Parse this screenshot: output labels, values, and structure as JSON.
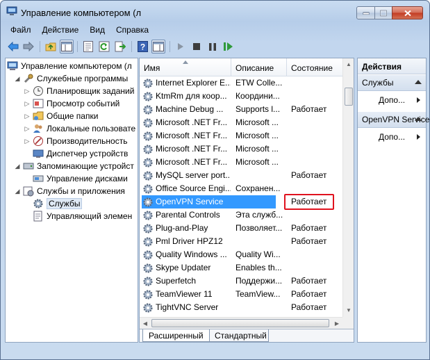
{
  "window": {
    "title": "Управление компьютером (л",
    "buttons": {
      "minimize": "minimize",
      "maximize": "maximize",
      "close": "close"
    }
  },
  "menu": [
    "Файл",
    "Действие",
    "Вид",
    "Справка"
  ],
  "toolbar": {
    "icons": [
      "back-arrow-icon",
      "forward-arrow-icon",
      "up-folder-icon",
      "show-tree-icon",
      "properties-icon",
      "refresh-icon",
      "export-icon",
      "help-icon",
      "show-action-pane-icon",
      "start-icon",
      "stop-icon",
      "pause-icon",
      "resume-icon"
    ]
  },
  "tree": [
    {
      "label": "Управление компьютером (л",
      "level": 0,
      "toggle": "",
      "icon": "computer-management-icon"
    },
    {
      "label": "Служебные программы",
      "level": 1,
      "toggle": "expanded",
      "icon": "tools-icon"
    },
    {
      "label": "Планировщик заданий",
      "level": 2,
      "toggle": "collapsed",
      "icon": "clock-icon"
    },
    {
      "label": "Просмотр событий",
      "level": 2,
      "toggle": "collapsed",
      "icon": "event-viewer-icon"
    },
    {
      "label": "Общие папки",
      "level": 2,
      "toggle": "collapsed",
      "icon": "shared-folder-icon"
    },
    {
      "label": "Локальные пользовате",
      "level": 2,
      "toggle": "collapsed",
      "icon": "users-icon"
    },
    {
      "label": "Производительность",
      "level": 2,
      "toggle": "collapsed",
      "icon": "performance-icon"
    },
    {
      "label": "Диспетчер устройств",
      "level": 2,
      "toggle": "",
      "icon": "device-manager-icon"
    },
    {
      "label": "Запоминающие устройст",
      "level": 1,
      "toggle": "expanded",
      "icon": "storage-icon"
    },
    {
      "label": "Управление дисками",
      "level": 2,
      "toggle": "",
      "icon": "disk-icon"
    },
    {
      "label": "Службы и приложения",
      "level": 1,
      "toggle": "expanded",
      "icon": "services-apps-icon"
    },
    {
      "label": "Службы",
      "level": 2,
      "toggle": "",
      "icon": "gear-icon",
      "selected": true
    },
    {
      "label": "Управляющий элемен",
      "level": 2,
      "toggle": "",
      "icon": "wmi-control-icon"
    }
  ],
  "list": {
    "columns": [
      "Имя",
      "Описание",
      "Состояние"
    ],
    "rows": [
      {
        "name": "Internet Explorer E...",
        "desc": "ETW Colle...",
        "state": ""
      },
      {
        "name": "KtmRm для коор...",
        "desc": "Координи...",
        "state": ""
      },
      {
        "name": "Machine Debug ...",
        "desc": "Supports l...",
        "state": "Работает"
      },
      {
        "name": "Microsoft .NET Fr...",
        "desc": "Microsoft ...",
        "state": ""
      },
      {
        "name": "Microsoft .NET Fr...",
        "desc": "Microsoft ...",
        "state": ""
      },
      {
        "name": "Microsoft .NET Fr...",
        "desc": "Microsoft ...",
        "state": ""
      },
      {
        "name": "Microsoft .NET Fr...",
        "desc": "Microsoft ...",
        "state": ""
      },
      {
        "name": "MySQL server port...",
        "desc": "",
        "state": "Работает"
      },
      {
        "name": "Office Source Engi...",
        "desc": "Сохранен...",
        "state": ""
      },
      {
        "name": "OpenVPN Service",
        "desc": "",
        "state": "Работает",
        "selected": true,
        "highlight": true
      },
      {
        "name": "Parental Controls",
        "desc": "Эта служб...",
        "state": ""
      },
      {
        "name": "Plug-and-Play",
        "desc": "Позволяет...",
        "state": "Работает"
      },
      {
        "name": "Pml Driver HPZ12",
        "desc": "",
        "state": "Работает"
      },
      {
        "name": "Quality Windows ...",
        "desc": "Quality Wi...",
        "state": ""
      },
      {
        "name": "Skype Updater",
        "desc": "Enables th...",
        "state": ""
      },
      {
        "name": "Superfetch",
        "desc": "Поддержи...",
        "state": "Работает"
      },
      {
        "name": "TeamViewer 11",
        "desc": "TeamView...",
        "state": "Работает"
      },
      {
        "name": "TightVNC Server",
        "desc": "",
        "state": "Работает"
      }
    ],
    "tabs": [
      "Расширенный",
      "Стандартный"
    ]
  },
  "actions": {
    "header": "Действия",
    "sections": [
      {
        "title": "Службы",
        "item": "Допо..."
      },
      {
        "title": "OpenVPN Service",
        "item": "Допо..."
      }
    ]
  }
}
